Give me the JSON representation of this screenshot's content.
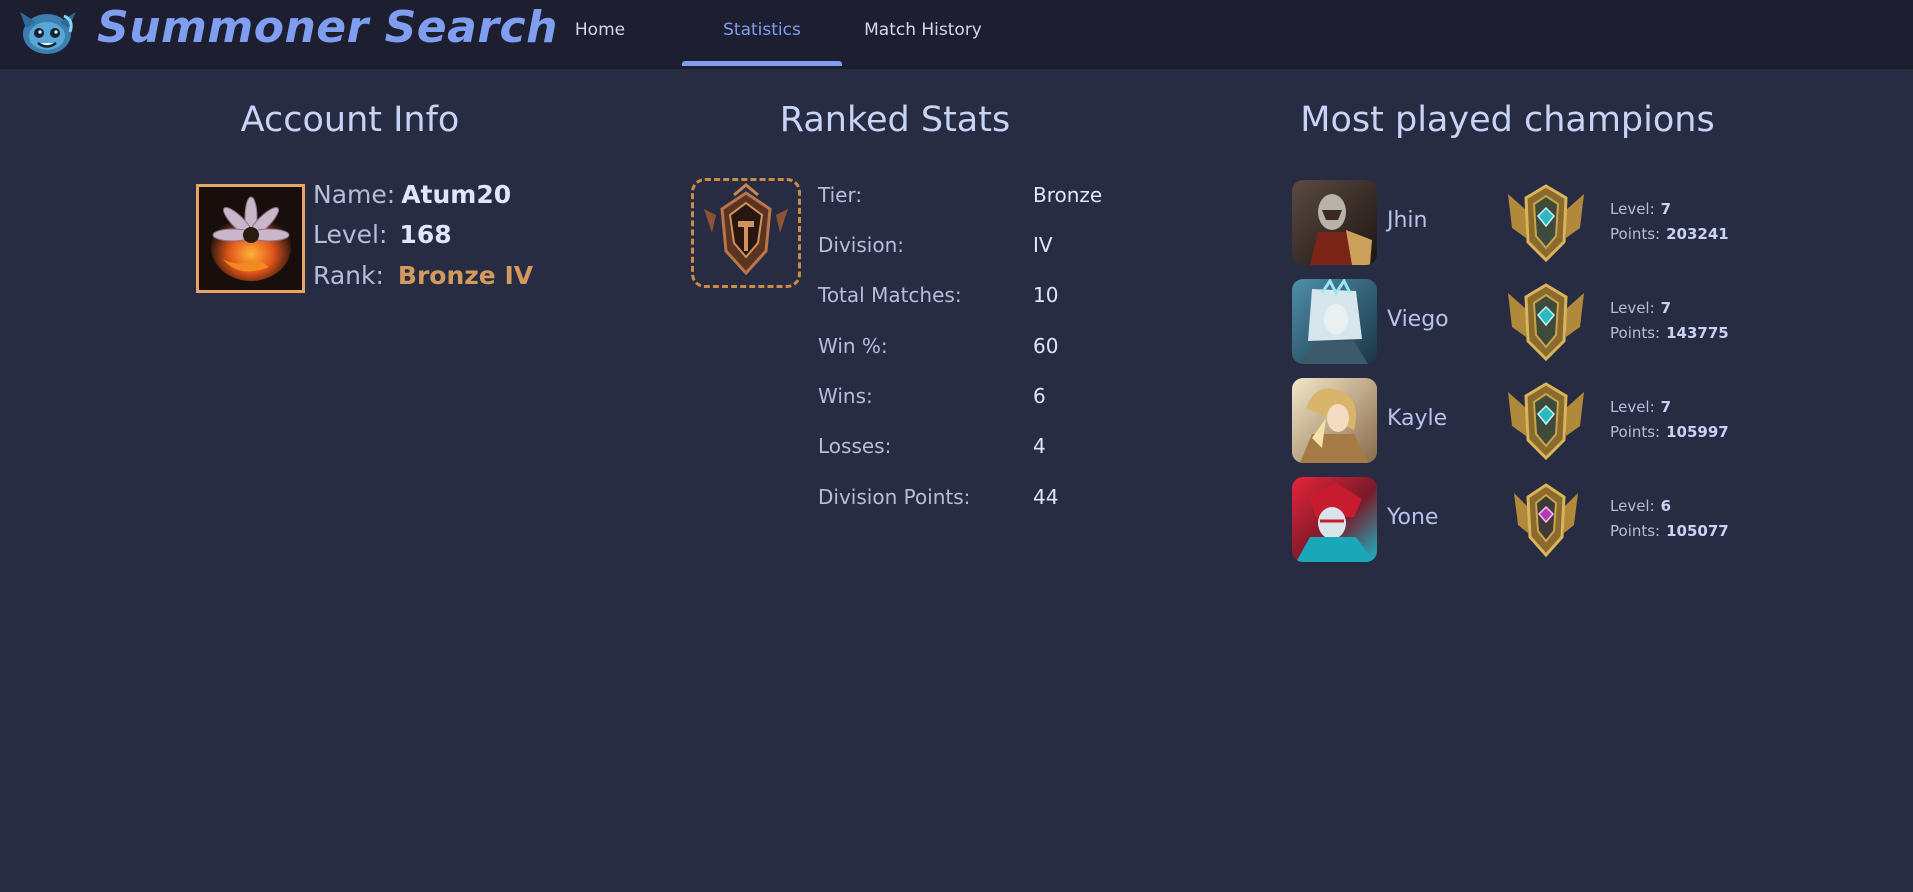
{
  "header": {
    "app_title": "Summoner Search",
    "logo_icon": "poro-logo-icon",
    "nav": [
      {
        "label": "Home",
        "active": false
      },
      {
        "label": "Statistics",
        "active": true
      },
      {
        "label": "Match History",
        "active": false
      }
    ],
    "accent_color": "#7f9ef0"
  },
  "account": {
    "heading": "Account Info",
    "name_label": "Name:",
    "name": "Atum20",
    "level_label": "Level:",
    "level": "168",
    "rank_label": "Rank:",
    "rank": "Bronze IV",
    "avatar_icon": "flower-avatar-icon"
  },
  "ranked": {
    "heading": "Ranked Stats",
    "emblem_icon": "bronze-emblem-icon",
    "rows": [
      {
        "label": "Tier:",
        "value": "Bronze"
      },
      {
        "label": "Division:",
        "value": "IV"
      },
      {
        "label": "Total Matches:",
        "value": "10"
      },
      {
        "label": "Win %:",
        "value": "60"
      },
      {
        "label": "Wins:",
        "value": "6"
      },
      {
        "label": "Losses:",
        "value": "4"
      },
      {
        "label": "Division Points:",
        "value": "44"
      }
    ]
  },
  "champions": {
    "heading": "Most played champions",
    "level_label": "Level:",
    "points_label": "Points:",
    "list": [
      {
        "name": "Jhin",
        "level": "7",
        "points": "203241",
        "mastery_icon": "mastery-7-icon"
      },
      {
        "name": "Viego",
        "level": "7",
        "points": "143775",
        "mastery_icon": "mastery-7-icon"
      },
      {
        "name": "Kayle",
        "level": "7",
        "points": "105997",
        "mastery_icon": "mastery-7-icon"
      },
      {
        "name": "Yone",
        "level": "6",
        "points": "105077",
        "mastery_icon": "mastery-6-icon"
      }
    ]
  }
}
